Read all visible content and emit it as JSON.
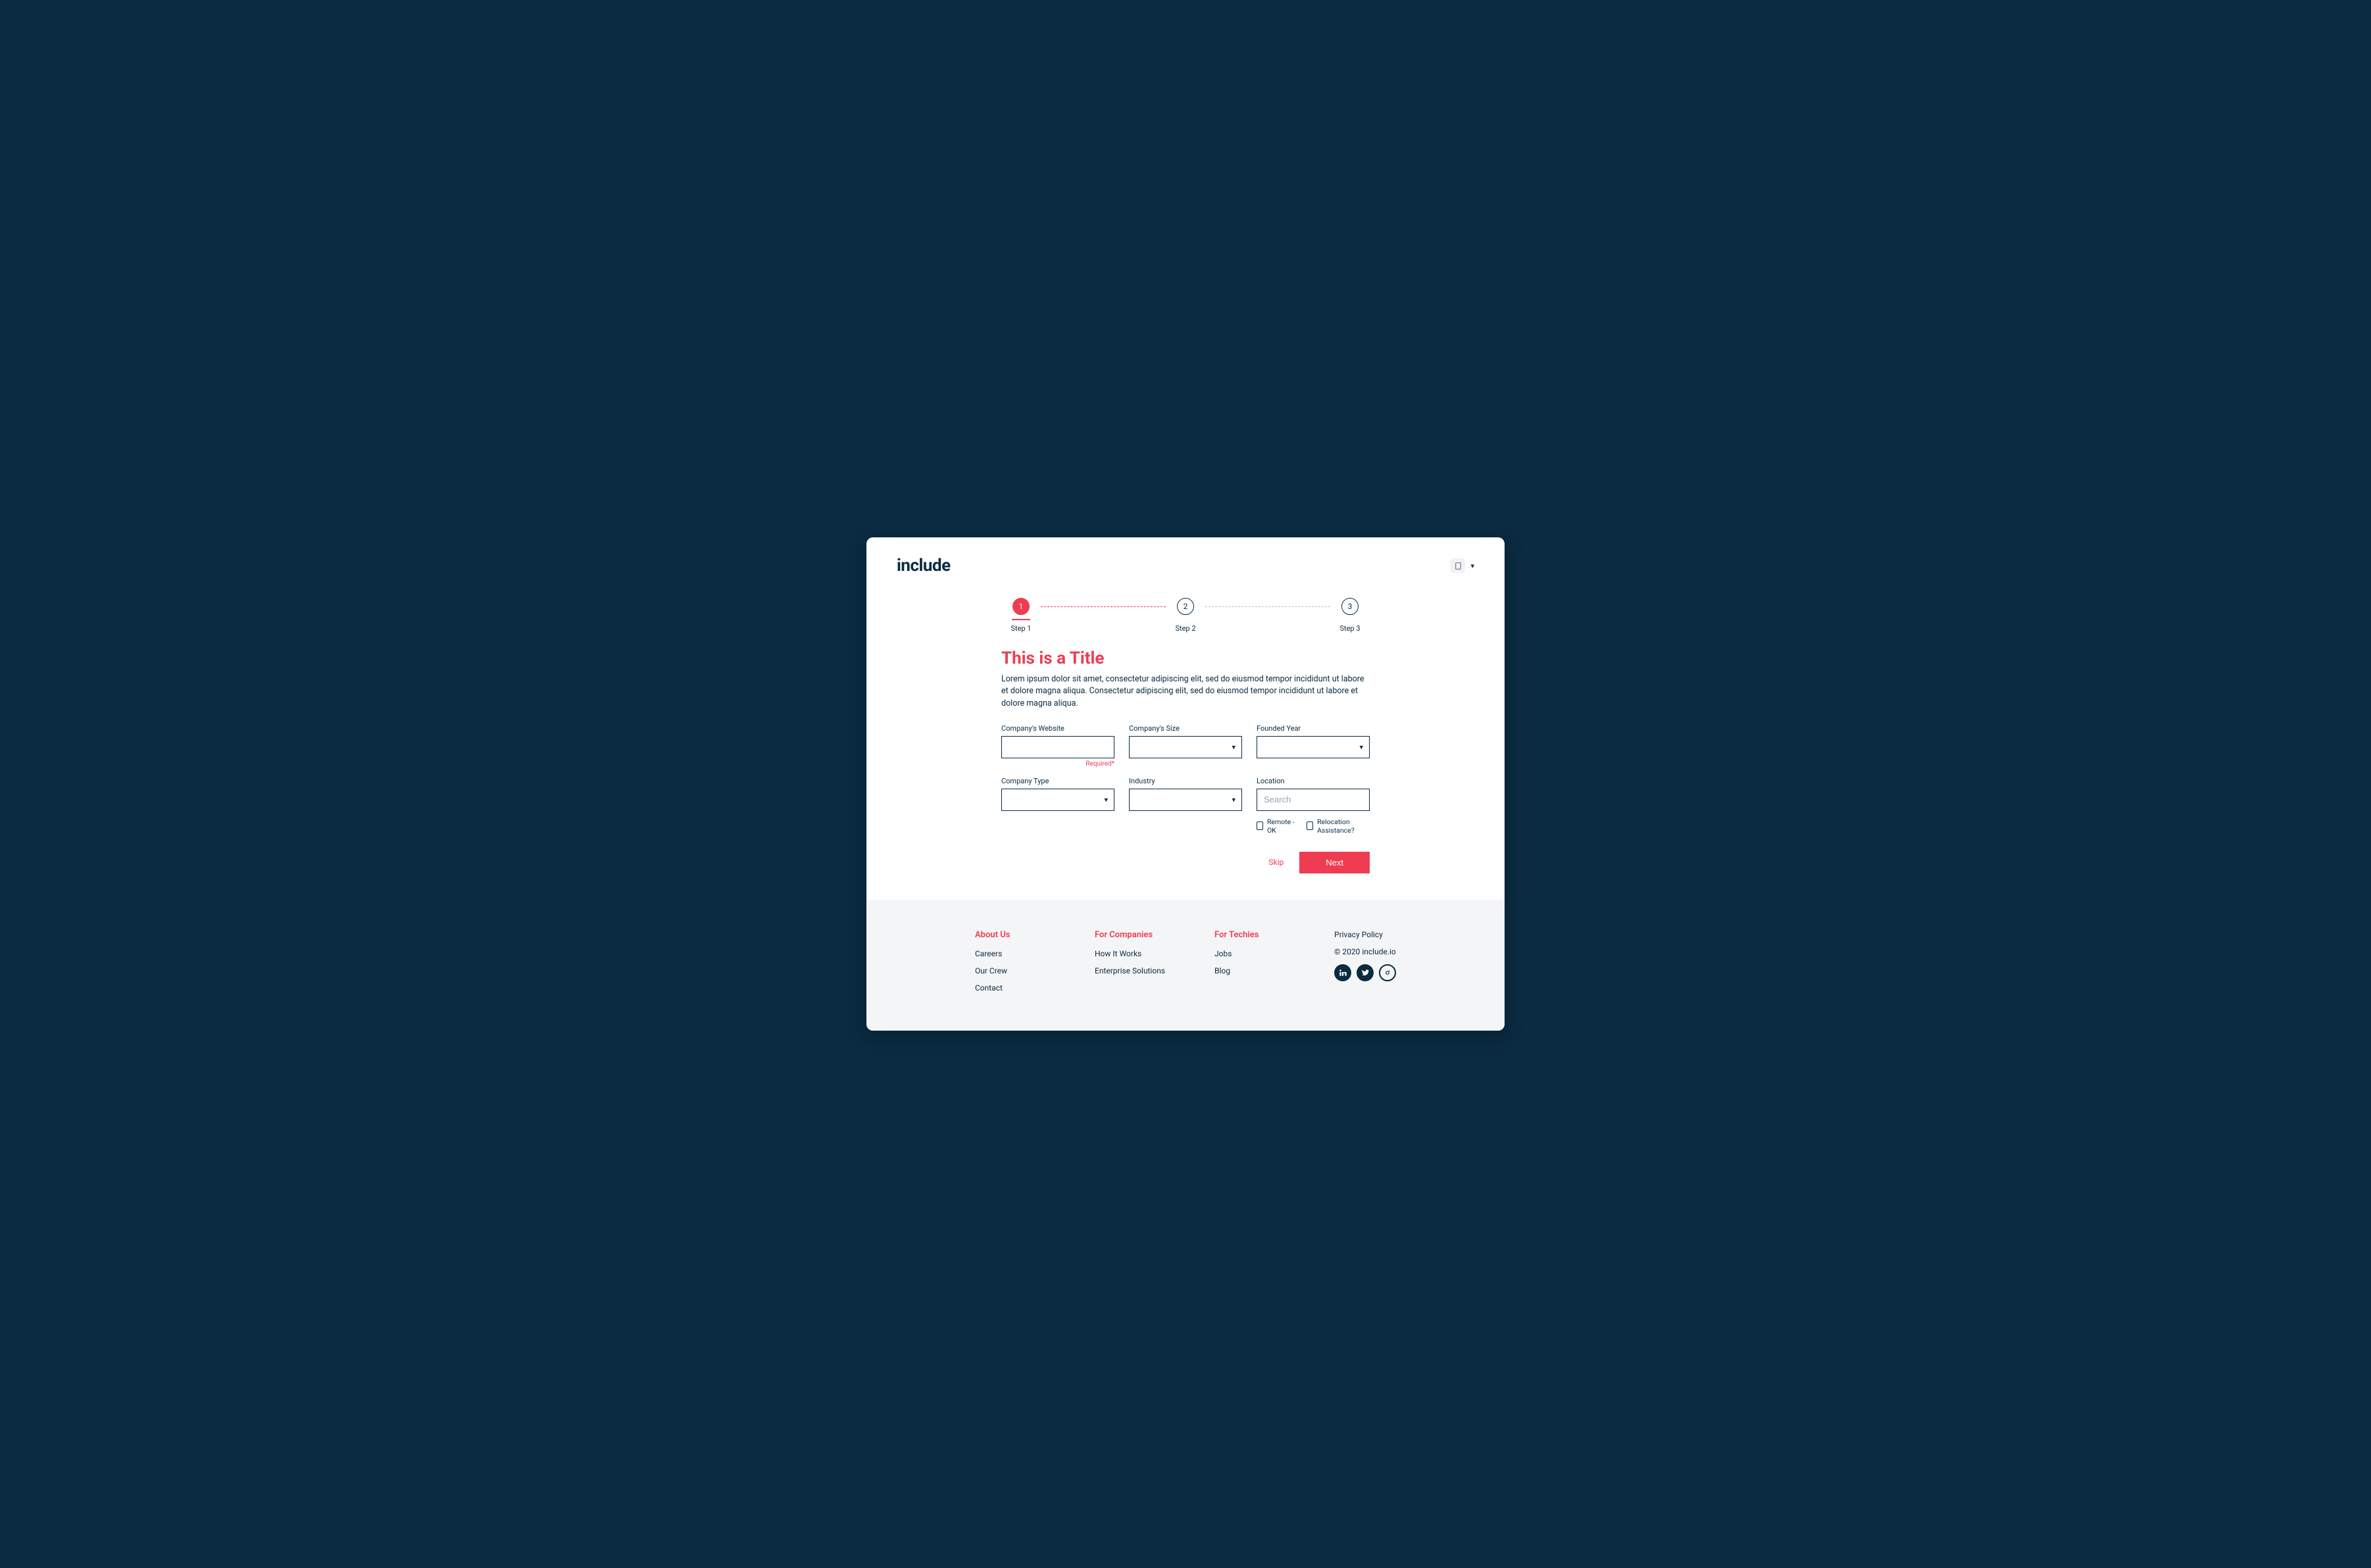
{
  "header": {
    "logo": "include"
  },
  "stepper": {
    "steps": [
      {
        "num": "1",
        "label": "Step 1",
        "active": true
      },
      {
        "num": "2",
        "label": "Step 2",
        "active": false
      },
      {
        "num": "3",
        "label": "Step 3",
        "active": false
      }
    ]
  },
  "page": {
    "title": "This is a Title",
    "description": "Lorem ipsum dolor sit amet, consectetur adipiscing elit, sed do eiusmod tempor incididunt ut labore et dolore magna aliqua. Consectetur adipiscing elit, sed do eiusmod tempor incididunt ut labore et dolore magna aliqua."
  },
  "form": {
    "website": {
      "label": "Company's Website",
      "value": "",
      "required_hint": "Required*"
    },
    "size": {
      "label": "Company's Size",
      "value": ""
    },
    "founded": {
      "label": "Founded Year",
      "value": ""
    },
    "company_type": {
      "label": "Company Type",
      "value": ""
    },
    "industry": {
      "label": "Industry",
      "value": ""
    },
    "location": {
      "label": "Location",
      "placeholder": "Search",
      "value": ""
    },
    "remote_label": "Remote - OK",
    "relocation_label": "Relocation Assistance?"
  },
  "actions": {
    "skip": "Skip",
    "next": "Next"
  },
  "footer": {
    "about": {
      "heading": "About Us",
      "links": [
        "Careers",
        "Our Crew",
        "Contact"
      ]
    },
    "companies": {
      "heading": "For Companies",
      "links": [
        "How It Works",
        "Enterprise Solutions"
      ]
    },
    "techies": {
      "heading": "For Techies",
      "links": [
        "Jobs",
        "Blog"
      ]
    },
    "privacy": "Privacy Policy",
    "copyright": "© 2020 include.io"
  }
}
